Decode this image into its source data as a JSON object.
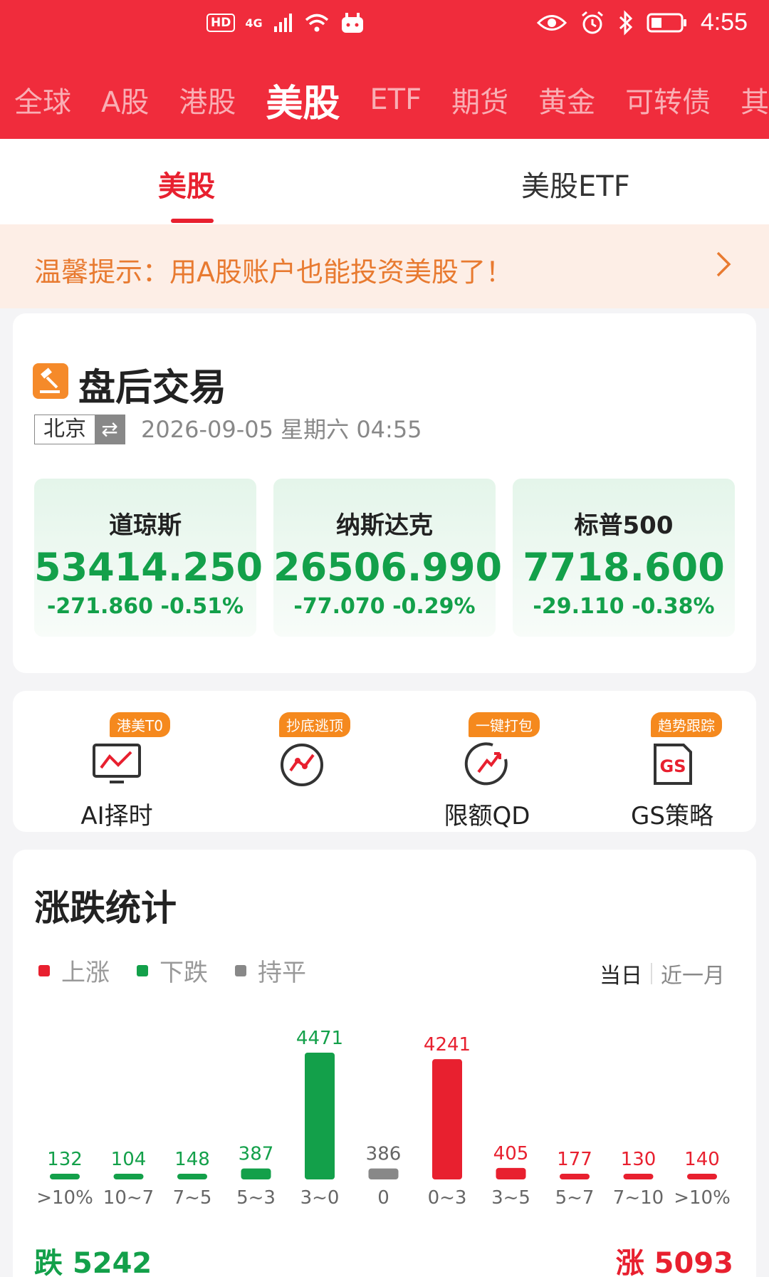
{
  "status_bar": {
    "time": "4:55",
    "hd": "HD",
    "network": "4G",
    "icons": [
      "signal-icon",
      "wifi-icon",
      "notification-icon",
      "eye-icon",
      "alarm-icon",
      "bluetooth-icon",
      "battery-icon"
    ]
  },
  "market_tabs": [
    {
      "label": "全球",
      "active": false
    },
    {
      "label": "A股",
      "active": false
    },
    {
      "label": "港股",
      "active": false
    },
    {
      "label": "美股",
      "active": true
    },
    {
      "label": "ETF",
      "active": false
    },
    {
      "label": "期货",
      "active": false
    },
    {
      "label": "黄金",
      "active": false
    },
    {
      "label": "可转债",
      "active": false
    },
    {
      "label": "其",
      "active": false
    }
  ],
  "sub_tabs": [
    {
      "label": "美股",
      "active": true
    },
    {
      "label": "美股ETF",
      "active": false
    }
  ],
  "notice": {
    "text": "温馨提示：用A股账户也能投资美股了！"
  },
  "after_hours": {
    "title": "盘后交易",
    "timezone": "北京",
    "switch_symbol": "⇄",
    "datetime": "2026-09-05 星期六   04:55",
    "indices": [
      {
        "name": "道琼斯",
        "value": "53414.250",
        "change": "-271.860",
        "pct": "-0.51%"
      },
      {
        "name": "纳斯达克",
        "value": "26506.990",
        "change": "-77.070",
        "pct": "-0.29%"
      },
      {
        "name": "标普500",
        "value": "7718.600",
        "change": "-29.110",
        "pct": "-0.38%"
      }
    ]
  },
  "tools": [
    {
      "label": "AI择时",
      "badge": "港美T0",
      "icon": "monitor-chart-icon"
    },
    {
      "label": "",
      "badge": "抄底逃顶",
      "icon": "trend-circle-icon"
    },
    {
      "label": "限额QD",
      "badge": "一键打包",
      "icon": "rocket-globe-icon"
    },
    {
      "label": "GS策略",
      "badge": "趋势跟踪",
      "icon": "gs-doc-icon"
    }
  ],
  "stats": {
    "title": "涨跌统计",
    "legend": [
      {
        "label": "上涨",
        "color": "#e8202f"
      },
      {
        "label": "下跌",
        "color": "#13a04a"
      },
      {
        "label": "持平",
        "color": "#888888"
      }
    ],
    "range_options": [
      {
        "label": "当日",
        "active": true
      },
      {
        "label": "近一月",
        "active": false
      }
    ],
    "total_down_label": "跌",
    "total_down": "5242",
    "total_up_label": "涨",
    "total_up": "5093"
  },
  "chart_data": {
    "type": "bar",
    "categories": [
      ">10%",
      "10~7",
      "7~5",
      "5~3",
      "3~0",
      "0",
      "0~3",
      "3~5",
      "5~7",
      "7~10",
      ">10%"
    ],
    "values": [
      132,
      104,
      148,
      387,
      4471,
      386,
      4241,
      405,
      177,
      130,
      140
    ],
    "bar_colors": [
      "#13a04a",
      "#13a04a",
      "#13a04a",
      "#13a04a",
      "#13a04a",
      "#888888",
      "#e8202f",
      "#e8202f",
      "#e8202f",
      "#e8202f",
      "#e8202f"
    ],
    "title": "",
    "xlabel": "",
    "ylabel": "",
    "grid": false
  }
}
